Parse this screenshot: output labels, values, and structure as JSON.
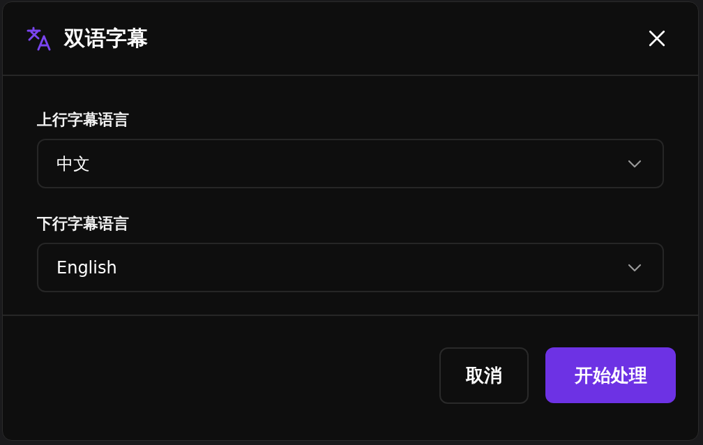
{
  "dialog": {
    "title": "双语字幕",
    "fields": [
      {
        "label": "上行字幕语言",
        "value": "中文"
      },
      {
        "label": "下行字幕语言",
        "value": "English"
      }
    ],
    "buttons": [
      {
        "label": "取消",
        "kind": "secondary"
      },
      {
        "label": "开始处理",
        "kind": "primary"
      }
    ]
  }
}
